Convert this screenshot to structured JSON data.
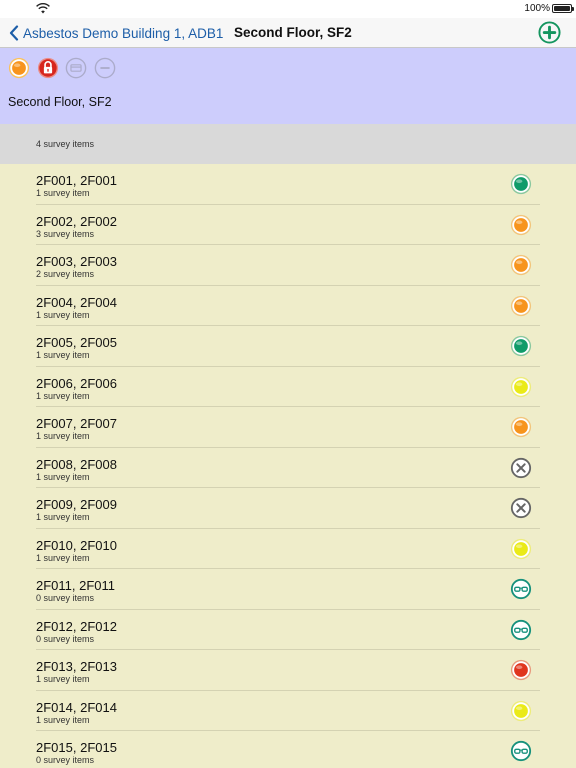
{
  "status_bar": {
    "battery": "100%"
  },
  "nav": {
    "back_label": "Asbestos Demo Building 1, ADB1",
    "title": "Second Floor, SF2"
  },
  "header": {
    "title": "Second Floor, SF2",
    "toolbar": [
      {
        "icon": "orange-status-icon",
        "color": "#f7941d",
        "enabled": true
      },
      {
        "icon": "lock-icon",
        "color": "#d7261e",
        "enabled": true
      },
      {
        "icon": "card-icon",
        "color": "#a9a9c9",
        "enabled": false
      },
      {
        "icon": "minus-icon",
        "color": "#a9a9c9",
        "enabled": false
      }
    ]
  },
  "summary": {
    "text": "4 survey items"
  },
  "items": [
    {
      "title": "2F001, 2F001",
      "subtitle": "1 survey item",
      "status": "green"
    },
    {
      "title": "2F002, 2F002",
      "subtitle": "3 survey items",
      "status": "orange"
    },
    {
      "title": "2F003, 2F003",
      "subtitle": "2 survey items",
      "status": "orange"
    },
    {
      "title": "2F004, 2F004",
      "subtitle": "1 survey item",
      "status": "orange"
    },
    {
      "title": "2F005, 2F005",
      "subtitle": "1 survey item",
      "status": "green"
    },
    {
      "title": "2F006, 2F006",
      "subtitle": "1 survey item",
      "status": "yellow"
    },
    {
      "title": "2F007, 2F007",
      "subtitle": "1 survey item",
      "status": "orange"
    },
    {
      "title": "2F008, 2F008",
      "subtitle": "1 survey item",
      "status": "cross"
    },
    {
      "title": "2F009, 2F009",
      "subtitle": "1 survey item",
      "status": "cross"
    },
    {
      "title": "2F010, 2F010",
      "subtitle": "1 survey item",
      "status": "yellow"
    },
    {
      "title": "2F011, 2F011",
      "subtitle": "0 survey items",
      "status": "glasses"
    },
    {
      "title": "2F012, 2F012",
      "subtitle": "0 survey items",
      "status": "glasses"
    },
    {
      "title": "2F013, 2F013",
      "subtitle": "1 survey item",
      "status": "red"
    },
    {
      "title": "2F014, 2F014",
      "subtitle": "1 survey item",
      "status": "yellow"
    },
    {
      "title": "2F015, 2F015",
      "subtitle": "0 survey items",
      "status": "glasses"
    }
  ],
  "status_colors": {
    "green": "#0f9b6a",
    "orange": "#f7941d",
    "yellow": "#eaea18",
    "red": "#e0351e",
    "cross": "#666666",
    "glasses": "#17917c"
  },
  "accent": "#1d5ea8"
}
